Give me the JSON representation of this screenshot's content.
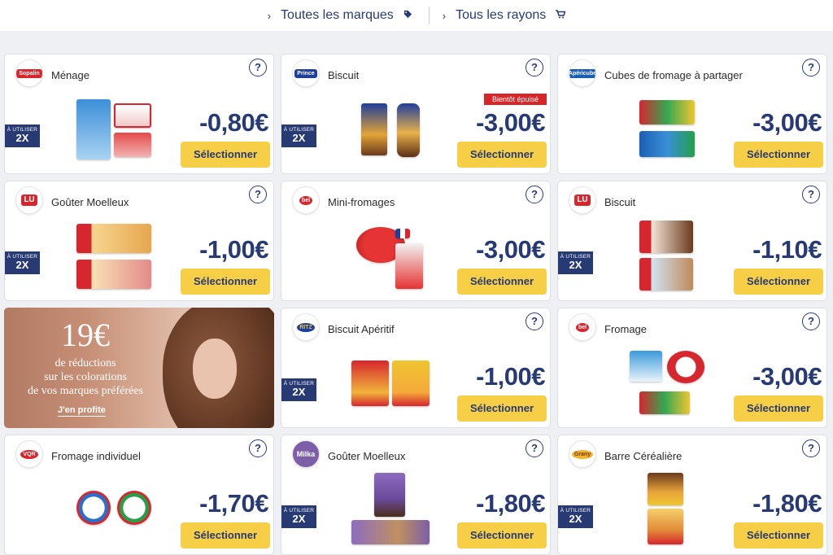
{
  "nav": {
    "brands_label": "Toutes les marques",
    "departments_label": "Tous les rayons"
  },
  "common": {
    "help": "?",
    "use_small": "À UTILISER",
    "use_big": "2X",
    "select_label": "Sélectionner"
  },
  "cards": [
    {
      "brand": "Sopalin",
      "category": "Ménage",
      "price": "-0,80€",
      "use2x": true
    },
    {
      "brand": "Prince",
      "category": "Biscuit",
      "price": "-3,00€",
      "use2x": true,
      "badge": "Bientôt épuisé"
    },
    {
      "brand": "Apéricube",
      "category": "Cubes de fromage à partager",
      "price": "-3,00€",
      "use2x": false
    },
    {
      "brand": "LU",
      "category": "Goûter Moelleux",
      "price": "-1,00€",
      "use2x": true
    },
    {
      "brand": "Babybel",
      "category": "Mini-fromages",
      "price": "-3,00€",
      "use2x": false
    },
    {
      "brand": "LU",
      "category": "Biscuit",
      "price": "-1,10€",
      "use2x": true
    },
    {
      "brand": "Ritz",
      "category": "Biscuit Apéritif",
      "price": "-1,00€",
      "use2x": true
    },
    {
      "brand": "Babybel",
      "category": "Fromage",
      "price": "-3,00€",
      "use2x": false
    },
    {
      "brand": "La vache qui rit",
      "category": "Fromage individuel",
      "price": "-1,70€",
      "use2x": false
    },
    {
      "brand": "Milka",
      "category": "Goûter Moelleux",
      "price": "-1,80€",
      "use2x": true
    },
    {
      "brand": "Grany",
      "category": "Barre Céréalière",
      "price": "-1,80€",
      "use2x": true
    }
  ],
  "promo": {
    "amount": "19€",
    "line1": "de réductions",
    "line2": "sur les colorations",
    "line3": "de vos marques préférées",
    "cta": "J'en profite"
  },
  "colors": {
    "navy": "#273a73",
    "yellow_button": "#f7cf46",
    "badge_red": "#d7262a"
  }
}
